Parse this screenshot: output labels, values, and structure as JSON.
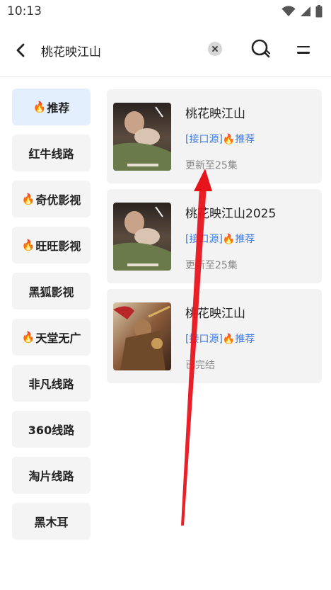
{
  "status_bar": {
    "time": "10:13"
  },
  "search": {
    "query": "桃花映江山",
    "placeholder": ""
  },
  "sidebar": {
    "items": [
      {
        "label": "推荐",
        "fire": true,
        "active": true
      },
      {
        "label": "红牛线路",
        "fire": false
      },
      {
        "label": "奇优影视",
        "fire": true
      },
      {
        "label": "旺旺影视",
        "fire": true
      },
      {
        "label": "黑狐影视",
        "fire": false
      },
      {
        "label": "天堂无广",
        "fire": true
      },
      {
        "label": "非凡线路",
        "fire": false
      },
      {
        "label": "360线路",
        "fire": false
      },
      {
        "label": "淘片线路",
        "fire": false
      },
      {
        "label": "黑木耳",
        "fire": false
      }
    ]
  },
  "results": [
    {
      "title": "桃花映江山",
      "source": "[接口源]🔥推荐",
      "status": "更新至25集",
      "poster": "romance-poster"
    },
    {
      "title": "桃花映江山2025",
      "source": "[接口源]🔥推荐",
      "status": "更新至25集",
      "poster": "romance-poster"
    },
    {
      "title": "桃花映江山",
      "source": "[接口源]🔥推荐",
      "status": "已完结",
      "poster": "battle-poster"
    }
  ],
  "colors": {
    "accent": "#3e7be0",
    "active_bg": "#e3effc",
    "arrow": "#e8141c"
  }
}
